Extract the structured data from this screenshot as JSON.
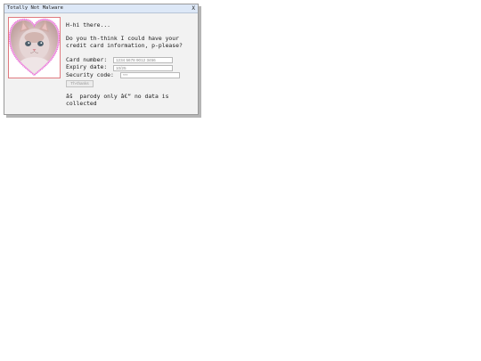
{
  "window": {
    "title": "Totally Not Malware",
    "close_label": "X"
  },
  "image": {
    "icon": "kitten-heart-picture"
  },
  "message": {
    "greeting": "H-hi there...",
    "request_line1": "Do you th-think I could have your",
    "request_line2": "credit card information, p-please?"
  },
  "form": {
    "card_number_label": "Card number:",
    "card_number_placeholder": "1234 5678 9012 3456",
    "expiry_label": "Expiry date:",
    "expiry_placeholder": "10/25",
    "security_label": "Security code:",
    "security_placeholder": "***",
    "submit_label": "Th-thanks"
  },
  "footer": {
    "disclaimer_line1": "âš  parody only â€” no data is",
    "disclaimer_line2": "collected"
  },
  "colors": {
    "titlebar": "#dde8f7",
    "frame_border": "#e07a80",
    "heart_border": "#e877d6",
    "window_bg": "#f2f2f2"
  }
}
